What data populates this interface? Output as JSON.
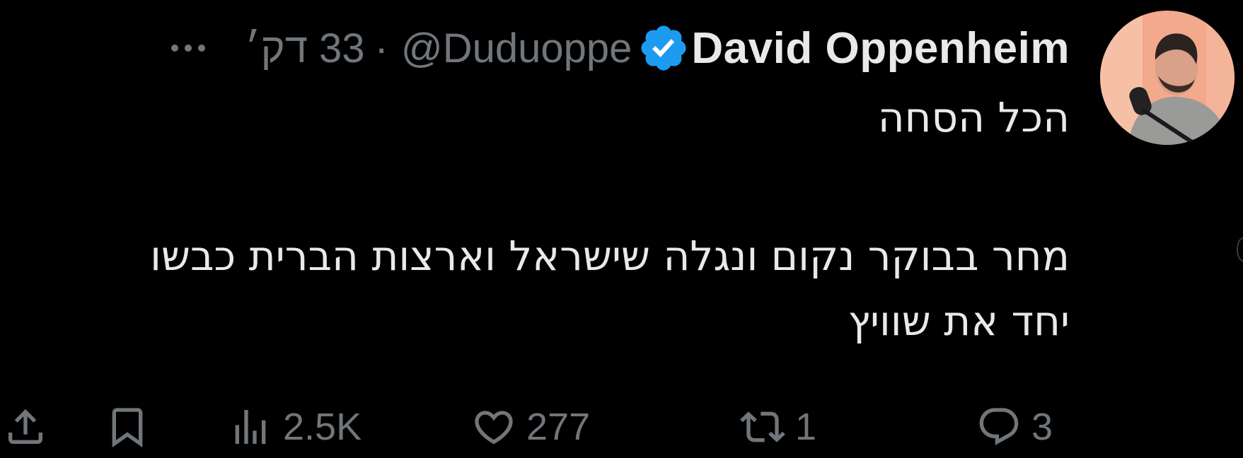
{
  "tweet": {
    "author": {
      "display_name": "David Oppenheim",
      "handle": "@Duduoppe",
      "verified": true,
      "verified_color": "#1d9bf0"
    },
    "separator": "·",
    "time": "33 דק׳",
    "more_icon": "more-horizontal-icon",
    "text_lines": [
      "הכל הסחה",
      "מחר בבוקר נקום ונגלה שישראל וארצות הברית כבשו",
      "יחד את שוויץ"
    ]
  },
  "actions": {
    "reply": {
      "icon": "reply-icon",
      "count": "3"
    },
    "retweet": {
      "icon": "retweet-icon",
      "count": "1"
    },
    "like": {
      "icon": "heart-icon",
      "count": "277"
    },
    "views": {
      "icon": "views-icon",
      "count": "2.5K"
    },
    "bookmark": {
      "icon": "bookmark-icon"
    },
    "share": {
      "icon": "share-icon"
    }
  },
  "colors": {
    "background": "#000000",
    "primary_text": "#e7e9ea",
    "secondary_text": "#71767b"
  }
}
